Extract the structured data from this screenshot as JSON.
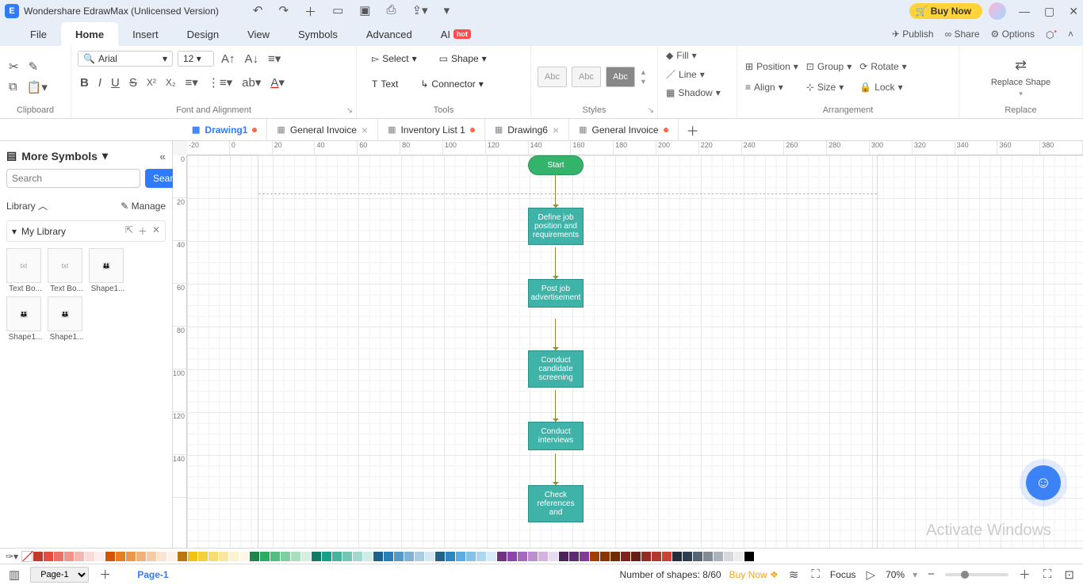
{
  "app": {
    "title": "Wondershare EdrawMax (Unlicensed Version)",
    "buy_now": "Buy Now"
  },
  "menu": {
    "file": "File",
    "home": "Home",
    "insert": "Insert",
    "design": "Design",
    "view": "View",
    "symbols": "Symbols",
    "advanced": "Advanced",
    "ai": "AI",
    "hot": "hot",
    "publish": "Publish",
    "share": "Share",
    "options": "Options"
  },
  "ribbon": {
    "clipboard": "Clipboard",
    "font_alignment": "Font and Alignment",
    "font_name": "Arial",
    "font_size": "12",
    "tools": "Tools",
    "select": "Select",
    "shape": "Shape",
    "text": "Text",
    "connector": "Connector",
    "styles": "Styles",
    "abc": "Abc",
    "fill": "Fill",
    "line": "Line",
    "shadow": "Shadow",
    "arrangement": "Arrangement",
    "position": "Position",
    "align": "Align",
    "group": "Group",
    "size": "Size",
    "rotate": "Rotate",
    "lock": "Lock",
    "replace": "Replace",
    "replace_shape": "Replace Shape"
  },
  "tabs": [
    {
      "name": "Drawing1",
      "active": true,
      "dirty": true,
      "closable": false
    },
    {
      "name": "General Invoice",
      "active": false,
      "dirty": false,
      "closable": true
    },
    {
      "name": "Inventory List 1",
      "active": false,
      "dirty": true,
      "closable": false
    },
    {
      "name": "Drawing6",
      "active": false,
      "dirty": false,
      "closable": true
    },
    {
      "name": "General Invoice",
      "active": false,
      "dirty": true,
      "closable": false
    }
  ],
  "left": {
    "more_symbols": "More Symbols",
    "search_placeholder": "Search",
    "search_btn": "Search",
    "library": "Library",
    "manage": "Manage",
    "my_library": "My Library",
    "shapes": [
      "Text Bo...",
      "Text Bo...",
      "Shape1...",
      "Shape1...",
      "Shape1..."
    ]
  },
  "ruler_h": [
    "-20",
    "0",
    "20",
    "40",
    "60",
    "80",
    "100",
    "120",
    "140",
    "160",
    "180",
    "200",
    "220",
    "240",
    "260",
    "280",
    "300",
    "320",
    "340",
    "360",
    "380"
  ],
  "ruler_v": [
    "0",
    "20",
    "40",
    "60",
    "80",
    "100",
    "120",
    "140"
  ],
  "flow": {
    "start": "Start",
    "n1": "Define job position and requirements",
    "n2": "Post job advertisement",
    "n3": "Conduct candidate screening",
    "n4": "Conduct interviews",
    "n5": "Check references and"
  },
  "colors": [
    "#c0392b",
    "#e74c3c",
    "#ec7063",
    "#f1948a",
    "#f5b7b1",
    "#fadbd8",
    "#fdedec",
    "#d35400",
    "#e67e22",
    "#eb984e",
    "#f0b27a",
    "#f5cba7",
    "#fae5d3",
    "#fdf2e9",
    "#b9770e",
    "#f1c40f",
    "#f4d03f",
    "#f7dc6f",
    "#f9e79f",
    "#fcf3cf",
    "#fef9e7",
    "#1e8449",
    "#27ae60",
    "#52be80",
    "#7dcea0",
    "#a9dfbf",
    "#d4efdf",
    "#117a65",
    "#16a085",
    "#45b39d",
    "#73c6b6",
    "#a2d9ce",
    "#d0ece7",
    "#1f618d",
    "#2980b9",
    "#5499c7",
    "#7fb3d5",
    "#a9cce3",
    "#d4e6f1",
    "#21618c",
    "#2e86c1",
    "#5dade2",
    "#85c1e9",
    "#aed6f1",
    "#d6eaf8",
    "#6c3483",
    "#8e44ad",
    "#a569bd",
    "#bb8fce",
    "#d2b4de",
    "#e8daef",
    "#4a235a",
    "#5b2c6f",
    "#7d3c98",
    "#a04000",
    "#873600",
    "#6e2c00",
    "#7b241c",
    "#641e16",
    "#922b21",
    "#b03a2e",
    "#cb4335",
    "#212f3c",
    "#2c3e50",
    "#566573",
    "#808b96",
    "#abb2b9",
    "#d5d8dc",
    "#eaecee",
    "#000000",
    "#ffffff"
  ],
  "status": {
    "page": "Page-1",
    "pagebtn": "Page-1",
    "shapes": "Number of shapes: 8/60",
    "buy": "Buy Now",
    "focus": "Focus",
    "zoom": "70%"
  },
  "watermark": "Activate Windows"
}
